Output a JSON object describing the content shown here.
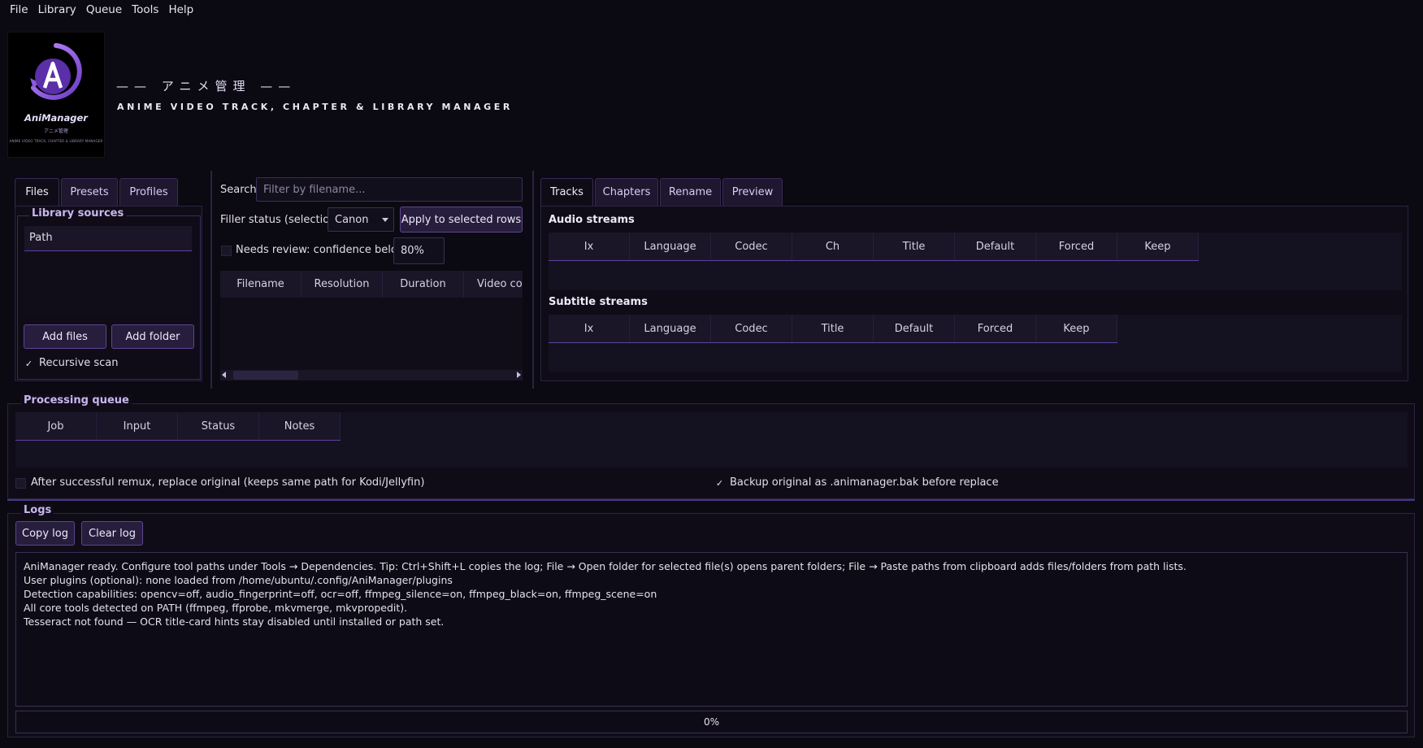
{
  "menu": [
    "File",
    "Library",
    "Queue",
    "Tools",
    "Help"
  ],
  "logo": {
    "name": "AniManager",
    "jp": "アニメ管理",
    "tagline": "ANIME VIDEO TRACK, CHAPTER & LIBRARY MANAGER"
  },
  "header": {
    "jp_title": "—— アニメ管理 ——",
    "subtitle": "ANIME VIDEO TRACK, CHAPTER & LIBRARY MANAGER"
  },
  "left_tabs": [
    "Files",
    "Presets",
    "Profiles"
  ],
  "library": {
    "title": "Library sources",
    "column": "Path",
    "add_files": "Add files",
    "add_folder": "Add folder",
    "recursive_label": "Recursive scan",
    "recursive_checked": true
  },
  "middle": {
    "search_label": "Search",
    "search_placeholder": "Filter by filename...",
    "filler_label": "Filler status (selection)",
    "filler_value": "Canon",
    "apply_button": "Apply to selected rows",
    "review_label": "Needs review: confidence below",
    "review_checked": false,
    "review_value": "80%",
    "columns": [
      "Filename",
      "Resolution",
      "Duration",
      "Video cod"
    ]
  },
  "right_tabs": [
    "Tracks",
    "Chapters",
    "Rename",
    "Preview"
  ],
  "audio": {
    "title": "Audio streams",
    "columns": [
      "Ix",
      "Language",
      "Codec",
      "Ch",
      "Title",
      "Default",
      "Forced",
      "Keep"
    ]
  },
  "subtitle": {
    "title": "Subtitle streams",
    "columns": [
      "Ix",
      "Language",
      "Codec",
      "Title",
      "Default",
      "Forced",
      "Keep"
    ]
  },
  "queue": {
    "title": "Processing queue",
    "columns": [
      "Job",
      "Input",
      "Status",
      "Notes"
    ],
    "replace_label": "After successful remux, replace original (keeps same path for Kodi/Jellyfin)",
    "replace_checked": false,
    "backup_label": "Backup original as .animanager.bak before replace",
    "backup_checked": true
  },
  "logs": {
    "title": "Logs",
    "copy_button": "Copy log",
    "clear_button": "Clear log",
    "lines": [
      "AniManager ready. Configure tool paths under Tools → Dependencies. Tip: Ctrl+Shift+L copies the log; File → Open folder for selected file(s) opens parent folders; File → Paste paths from clipboard adds files/folders from path lists.",
      "User plugins (optional): none loaded from /home/ubuntu/.config/AniManager/plugins",
      "Detection capabilities: opencv=off, audio_fingerprint=off, ocr=off, ffmpeg_silence=on, ffmpeg_black=on, ffmpeg_scene=on",
      "All core tools detected on PATH (ffmpeg, ffprobe, mkvmerge, mkvpropedit).",
      "Tesseract not found — OCR title-card hints stay disabled until installed or path set."
    ],
    "progress": "0%",
    "progress_value": 0
  },
  "colors": {
    "accent": "#7b4fd6",
    "background": "#0b0911",
    "button": "#271d3d"
  }
}
